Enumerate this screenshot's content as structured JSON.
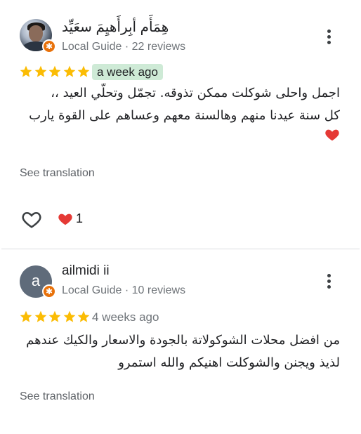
{
  "reviews": [
    {
      "author": "هِمَأَم أبِرأَهيِمَ سعَيِّد",
      "role": "Local Guide",
      "review_count": "22 reviews",
      "rating": 5,
      "time": "a week ago",
      "text_lines": [
        "اجمل واحلى شوكلت ممكن تذوقه. تجمّل وتحلّي العيد ،،",
        "كل سنة عيدنا منهم وهالسنة معهم وعساهم على القوة يارب"
      ],
      "translate_label": "See translation",
      "reaction_count": "1"
    },
    {
      "author": "ailmidi ii",
      "avatar_letter": "a",
      "role": "Local Guide",
      "review_count": "10 reviews",
      "rating": 5,
      "time": "4 weeks ago",
      "text_lines": [
        "من افضل محلات الشوكولاتة بالجودة والاسعار والكيك عندهم",
        "لذيذ ويجنن والشوكلت اهنيكم والله استمرو"
      ],
      "translate_label": "See translation"
    }
  ],
  "colors": {
    "star": "#fbbc04",
    "badge": "#e8710a",
    "time_highlight": "#ceead6",
    "heart": "#e53935"
  },
  "icons": [
    "more-vert-icon",
    "star-icon",
    "heart-outline-icon",
    "red-heart-icon",
    "local-guide-badge-icon"
  ]
}
